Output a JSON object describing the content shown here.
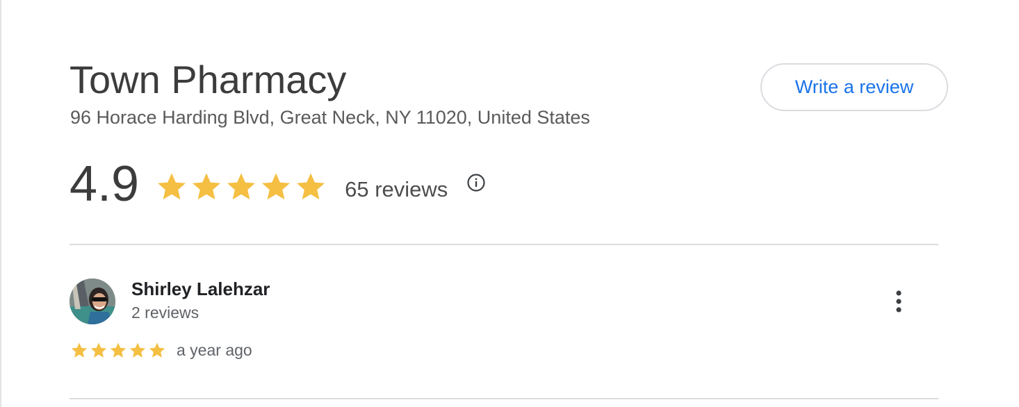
{
  "place": {
    "title": "Town Pharmacy",
    "address": "96 Horace Harding Blvd, Great Neck, NY 11020, United States"
  },
  "actions": {
    "write_review_label": "Write a review"
  },
  "rating": {
    "value": "4.9",
    "stars": 5,
    "review_count_label": "65 reviews",
    "info_icon": "info-icon"
  },
  "review": {
    "author_name": "Shirley Lalehzar",
    "author_meta": "2 reviews",
    "stars": 5,
    "time": "a year ago",
    "more_icon": "more-vert-icon"
  },
  "colors": {
    "star": "#F4BF42",
    "link_blue": "#1A73E8",
    "divider": "#DCDCDC"
  }
}
